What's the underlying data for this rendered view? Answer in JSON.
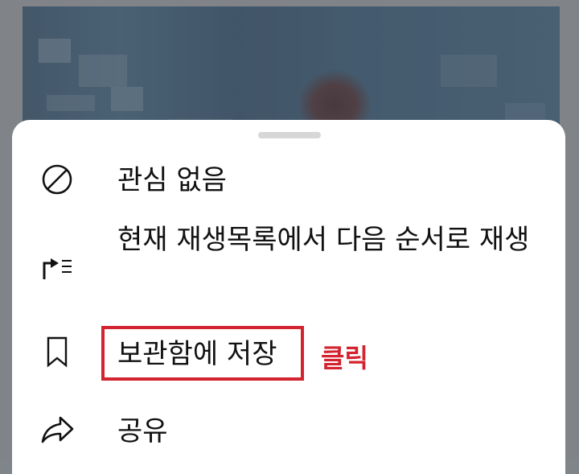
{
  "menu": {
    "items": [
      {
        "label": "관심 없음",
        "icon": "not-interested-icon"
      },
      {
        "label": "현재 재생목록에서 다음 순서로 재생",
        "icon": "play-next-in-queue-icon"
      },
      {
        "label": "보관함에 저장",
        "icon": "bookmark-icon"
      },
      {
        "label": "공유",
        "icon": "share-icon"
      }
    ]
  },
  "annotation": {
    "text": "클릭",
    "color": "#d3232f"
  },
  "colors": {
    "sheet_background": "#ffffff",
    "scrim": "#8a8e91",
    "highlight": "#d3232f",
    "text": "#111111"
  }
}
